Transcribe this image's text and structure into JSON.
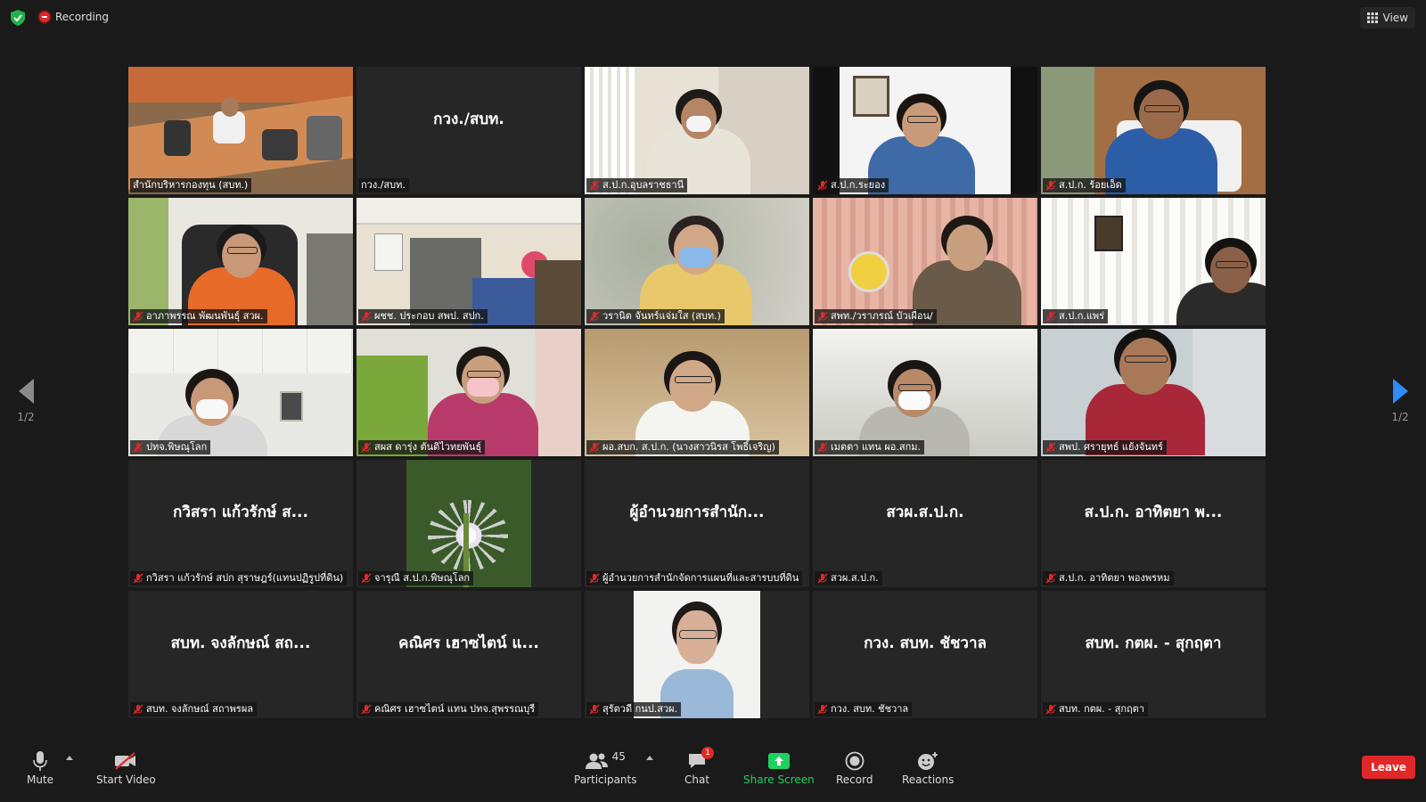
{
  "top": {
    "recording_label": "Recording",
    "view_label": "View"
  },
  "pager": {
    "left_page": "1/2",
    "right_page": "1/2"
  },
  "tiles": [
    {
      "label": "สำนักบริหารกองทุน (สบท.)",
      "big": "",
      "muted": false,
      "video": "meeting-room"
    },
    {
      "label": "กวง./สบท.",
      "big": "กวง./สบท.",
      "muted": false,
      "video": "none"
    },
    {
      "label": "ส.ป.ก.อุบลราชธานี",
      "big": "",
      "muted": true,
      "video": "woman-phone"
    },
    {
      "label": "ส.ป.ก.ระยอง",
      "big": "",
      "muted": true,
      "video": "woman-desk"
    },
    {
      "label": "ส.ป.ก. ร้อยเอ็ด",
      "big": "",
      "muted": true,
      "video": "man-shirt"
    },
    {
      "label": "อาภาพรรณ พัฒนพันธุ์ สวผ.",
      "big": "",
      "muted": true,
      "video": "woman-office"
    },
    {
      "label": "ผชช. ประกอบ สพป. สปก.",
      "big": "",
      "muted": true,
      "video": "office-shelves"
    },
    {
      "label": "วรานิต จันทร์แจ่มใส (สบท.)",
      "big": "",
      "muted": true,
      "video": "woman-mask-blue"
    },
    {
      "label": "สพท./วราภรณ์ บัวเผื่อน/",
      "big": "",
      "muted": true,
      "video": "woman-fan"
    },
    {
      "label": "ส.ป.ก.แพร่",
      "big": "",
      "muted": true,
      "video": "man-curtain"
    },
    {
      "label": "ปทจ.พิษณุโลก",
      "big": "",
      "muted": true,
      "video": "woman-mask-ceiling"
    },
    {
      "label": "สผส ดารุ่ง ตันติไวทยพันธุ์",
      "big": "",
      "muted": true,
      "video": "woman-mask-pink"
    },
    {
      "label": "ผอ.สบก. ส.ป.ก. (นางสาวนิรส โพธิ์เจริญ)",
      "big": "",
      "muted": true,
      "video": "woman-older"
    },
    {
      "label": "เมตตา แทน ผอ.สกม.",
      "big": "",
      "muted": true,
      "video": "woman-mask-white"
    },
    {
      "label": "สพป. ศรายุทธ์ แย้งจันทร์",
      "big": "",
      "muted": true,
      "video": "man-glasses"
    },
    {
      "label": "กวิสรา แก้วรักษ์ สปก สุราษฎร์(แทนปฏิรูปที่ดิน)",
      "big": "กวิสรา แก้วรักษ์ ส...",
      "muted": true,
      "video": "none"
    },
    {
      "label": "จารุณี ส.ป.ก.พิษณุโลก",
      "big": "",
      "muted": true,
      "video": "flower"
    },
    {
      "label": "ผู้อำนวยการสำนักจัดการแผนที่และสารบบที่ดิน",
      "big": "ผู้อำนวยการสำนัก...",
      "muted": true,
      "video": "none"
    },
    {
      "label": "สวผ.ส.ป.ก.",
      "big": "สวผ.ส.ป.ก.",
      "muted": true,
      "video": "none"
    },
    {
      "label": "ส.ป.ก. อาทิตยา พองพรหม",
      "big": "ส.ป.ก. อาทิตยา พ...",
      "muted": true,
      "video": "none"
    },
    {
      "label": "สบท. จงลักษณ์ สถาพรผล",
      "big": "สบท. จงลักษณ์ สถ...",
      "muted": true,
      "video": "none"
    },
    {
      "label": "คณิศร เฮาซไตน์ แทน ปทจ.สุพรรณบุรี",
      "big": "คณิศร เฮาซไตน์ แ...",
      "muted": true,
      "video": "none"
    },
    {
      "label": "สุรัตวดี กนป.สวผ.",
      "big": "",
      "muted": true,
      "video": "portrait"
    },
    {
      "label": "กวง. สบท. ชัชวาล",
      "big": "กวง. สบท. ชัชวาล",
      "muted": true,
      "video": "none"
    },
    {
      "label": "สบท. กตผ. - สุกฤตา",
      "big": "สบท. กตผ. - สุกฤตา",
      "muted": true,
      "video": "none"
    }
  ],
  "toolbar": {
    "mute_label": "Mute",
    "video_label": "Start Video",
    "participants_label": "Participants",
    "participants_count": "45",
    "chat_label": "Chat",
    "chat_badge": "1",
    "share_label": "Share Screen",
    "record_label": "Record",
    "reactions_label": "Reactions",
    "leave_label": "Leave"
  },
  "colors": {
    "accent_blue": "#2d8cff",
    "share_green": "#1fd25f",
    "leave_red": "#e02828",
    "active_speaker": "#e8e34a"
  }
}
